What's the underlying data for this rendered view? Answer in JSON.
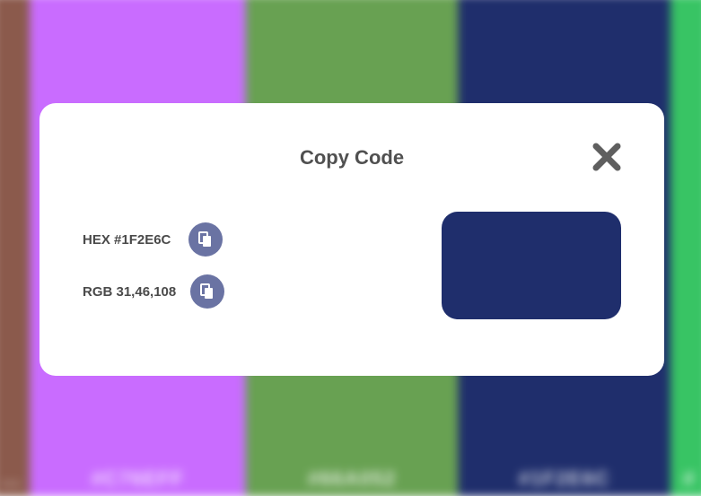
{
  "background": {
    "columns": [
      {
        "color": "#8b5a4c",
        "code": "..."
      },
      {
        "color": "#c96cff",
        "code": "#C76EFF"
      },
      {
        "color": "#68a152",
        "code": "#66A052"
      },
      {
        "color": "#1f2e6c",
        "code": "#1F2E6C"
      },
      {
        "color": "#38c464",
        "code": "#"
      }
    ]
  },
  "modal": {
    "title": "Copy Code",
    "hex_label": "HEX #1F2E6C",
    "rgb_label": "RGB 31,46,108",
    "swatch_color": "#1f2e6c",
    "close_icon": "close-icon",
    "copy_icon": "copy-icon"
  },
  "colors": {
    "button_bg": "#6a73a3",
    "title_text": "#505050"
  }
}
